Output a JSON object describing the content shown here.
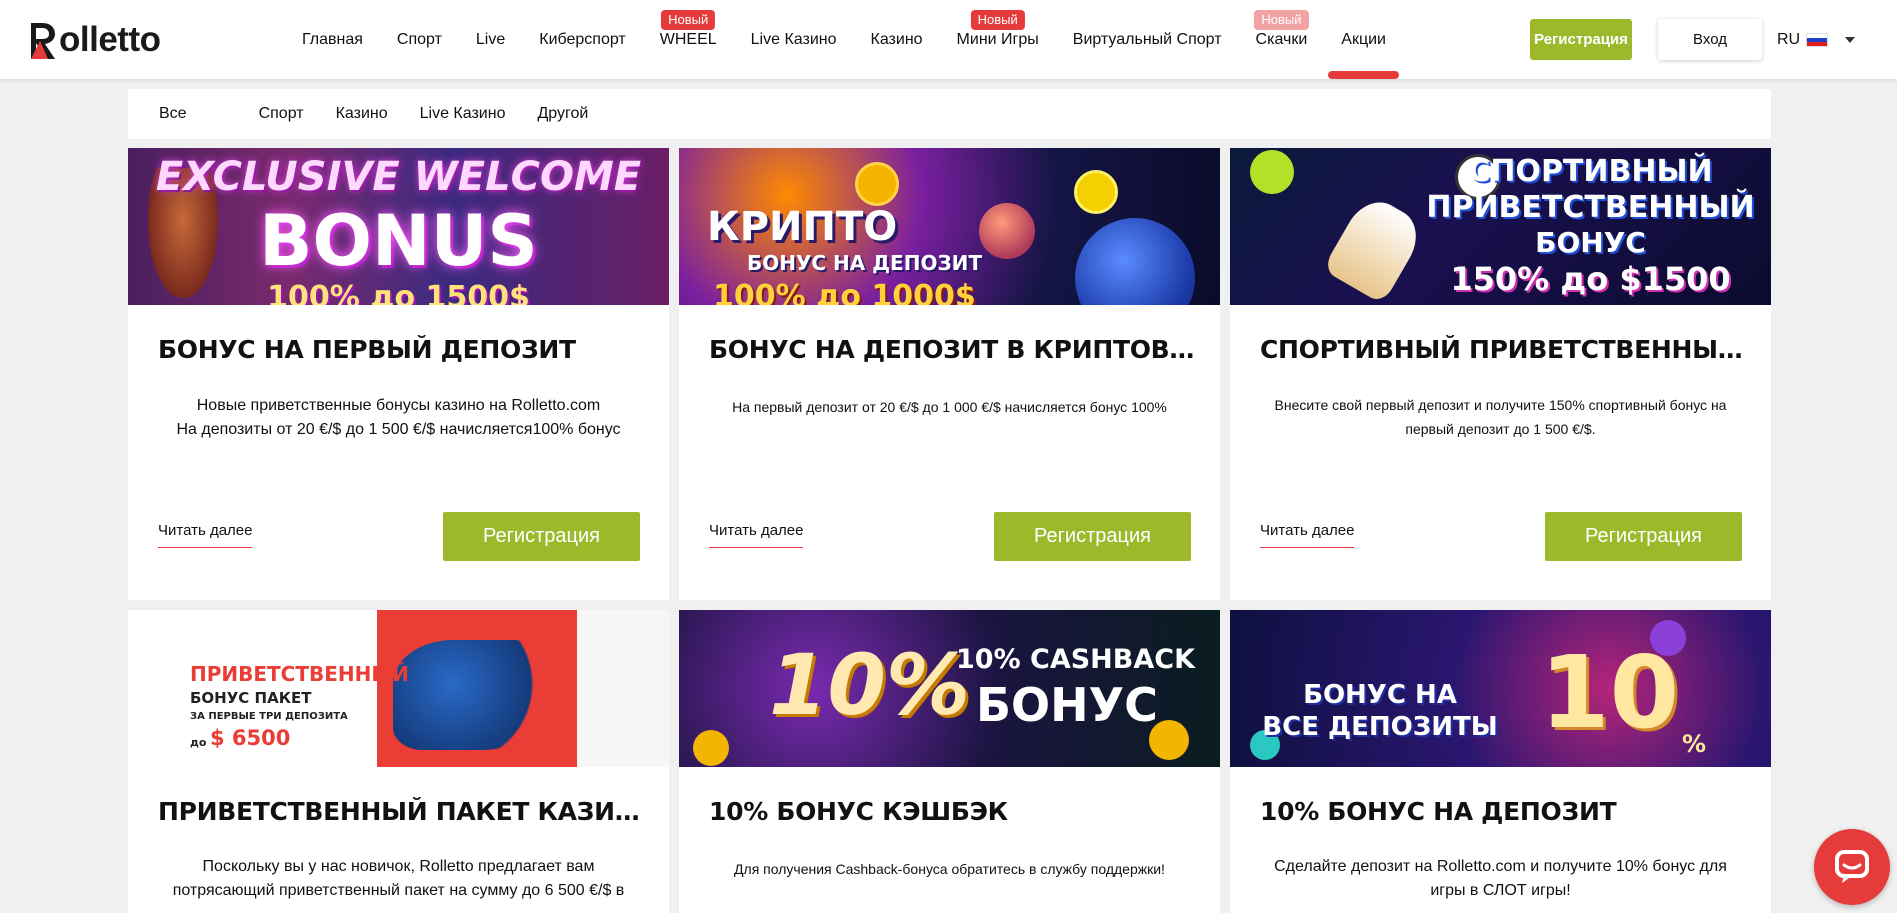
{
  "header": {
    "logo_text": "olletto",
    "nav": [
      {
        "label": "Главная",
        "badge": ""
      },
      {
        "label": "Спорт",
        "badge": ""
      },
      {
        "label": "Live",
        "badge": ""
      },
      {
        "label": "Киберспорт",
        "badge": ""
      },
      {
        "label": "WHEEL",
        "badge": "Новый"
      },
      {
        "label": "Live Казино",
        "badge": ""
      },
      {
        "label": "Казино",
        "badge": ""
      },
      {
        "label": "Мини Игры",
        "badge": "Новый"
      },
      {
        "label": "Виртуальный Спорт",
        "badge": ""
      },
      {
        "label": "Скачки",
        "badge": "Новый"
      },
      {
        "label": "Акции",
        "badge": ""
      }
    ],
    "register_label": "Регистрация",
    "login_label": "Вход",
    "language": "RU"
  },
  "filters": [
    "Все",
    "Спорт",
    "Казино",
    "Live Казино",
    "Другой"
  ],
  "cards": [
    {
      "banner_lines": [
        "EXCLUSIVE WELCOME",
        "BONUS",
        "100% до 1500$"
      ],
      "title": "БОНУС НА ПЕРВЫЙ ДЕПОЗИТ",
      "desc": [
        "Новые приветственные бонусы казино на Rolletto.com",
        "На депозиты от 20 €/$ до 1 500 €/$ начисляется100% бонус"
      ],
      "read_more": "Читать далее",
      "button": "Регистрация"
    },
    {
      "banner_lines": [
        "КРИПТО",
        "БОНУС НА ДЕПОЗИТ",
        "100% до 1000$"
      ],
      "title": "БОНУС НА ДЕПОЗИТ В КРИПТОВАЛЮТЕ",
      "desc": [
        "На первый депозит от 20 €/$ до 1 000 €/$ начисляется бонус 100%"
      ],
      "read_more": "Читать далее",
      "button": "Регистрация"
    },
    {
      "banner_lines": [
        "СПОРТИВНЫЙ",
        "ПРИВЕТСТВЕННЫЙ",
        "БОНУС",
        "150% до $1500"
      ],
      "title": "СПОРТИВНЫЙ ПРИВЕТСТВЕННЫЙ Б...",
      "desc": [
        "Внесите свой первый депозит и получите 150% спортивный бонус на первый депозит до 1 500 €/$."
      ],
      "read_more": "Читать далее",
      "button": "Регистрация"
    },
    {
      "banner_lines": [
        "ПРИВЕТСТВЕННЫЙ",
        "БОНУС ПАКЕТ",
        "ЗА ПЕРВЫЕ ТРИ ДЕПОЗИТА",
        "до",
        "$ 6500"
      ],
      "title": "ПРИВЕТСТВЕННЫЙ ПАКЕТ КАЗИНО",
      "desc": [
        "Поскольку вы у нас новичок, Rolletto предлагает вам потрясающий приветственный пакет на сумму до 6 500 €/$ в"
      ]
    },
    {
      "banner_lines": [
        "10%",
        "10% CASHBACK",
        "БОНУС"
      ],
      "title": "10% БОНУС КЭШБЭК",
      "desc": [
        "Для получения Cashback-бонуса обратитесь в службу поддержки!"
      ]
    },
    {
      "banner_lines": [
        "БОНУС НА",
        "ВСЕ ДЕПОЗИТЫ",
        "10",
        "%"
      ],
      "title": "10% БОНУС НА ДЕПОЗИТ",
      "desc": [
        "Сделайте депозит на Rolletto.com и получите 10% бонус для игры в СЛОТ игры!"
      ]
    }
  ],
  "colors": {
    "accent_red": "#e53b3b",
    "green": "#9cb92c"
  }
}
